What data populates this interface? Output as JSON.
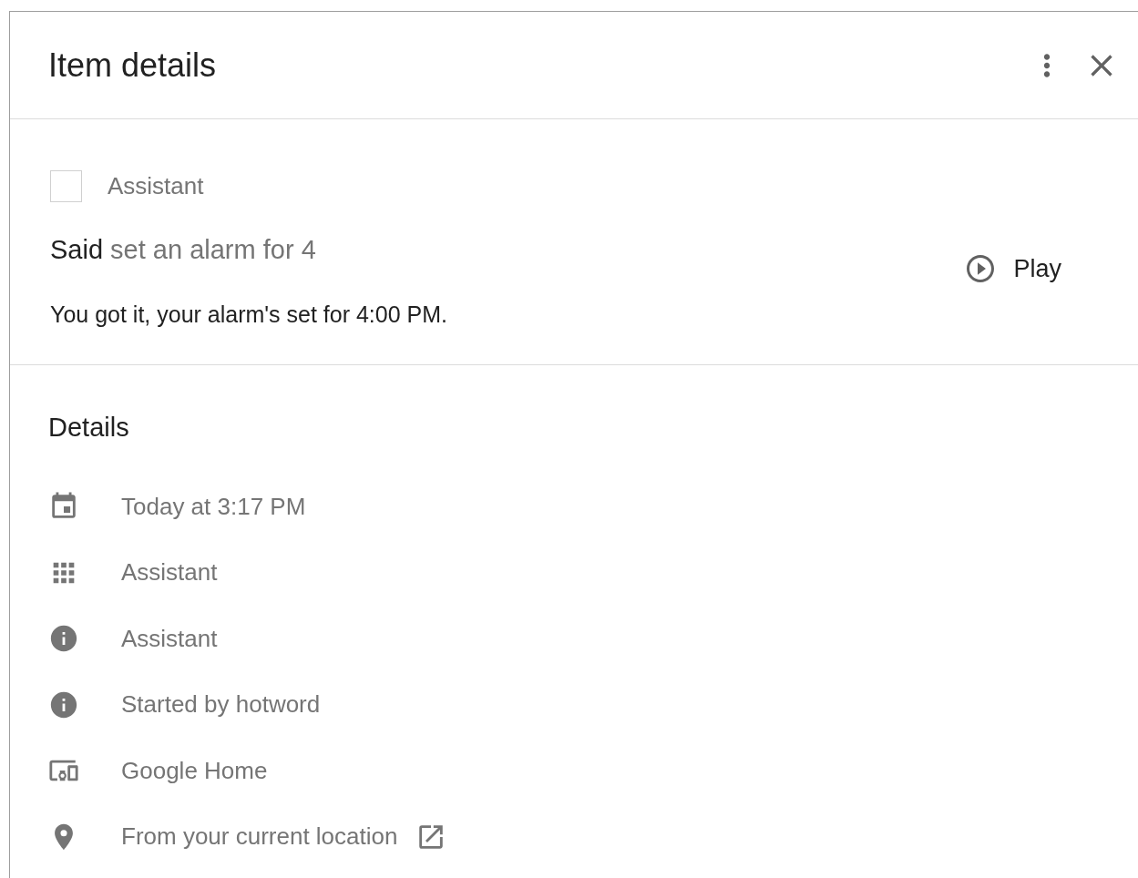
{
  "window": {
    "title": "Item details"
  },
  "item": {
    "checked": false,
    "product": "Assistant",
    "said_prefix": "Said",
    "query": "set an alarm for 4",
    "play": "Play",
    "response": "You got it, your alarm's set for 4:00 PM."
  },
  "details": {
    "title": "Details",
    "rows": [
      {
        "kind": "calendar",
        "text": "Today at 3:17 PM",
        "external_link": false
      },
      {
        "kind": "apps",
        "text": "Assistant",
        "external_link": false
      },
      {
        "kind": "info",
        "text": "Assistant",
        "external_link": false
      },
      {
        "kind": "info",
        "text": "Started by hotword",
        "external_link": false
      },
      {
        "kind": "devices",
        "text": "Google Home",
        "external_link": false
      },
      {
        "kind": "place",
        "text": "From your current location",
        "external_link": true
      }
    ]
  }
}
